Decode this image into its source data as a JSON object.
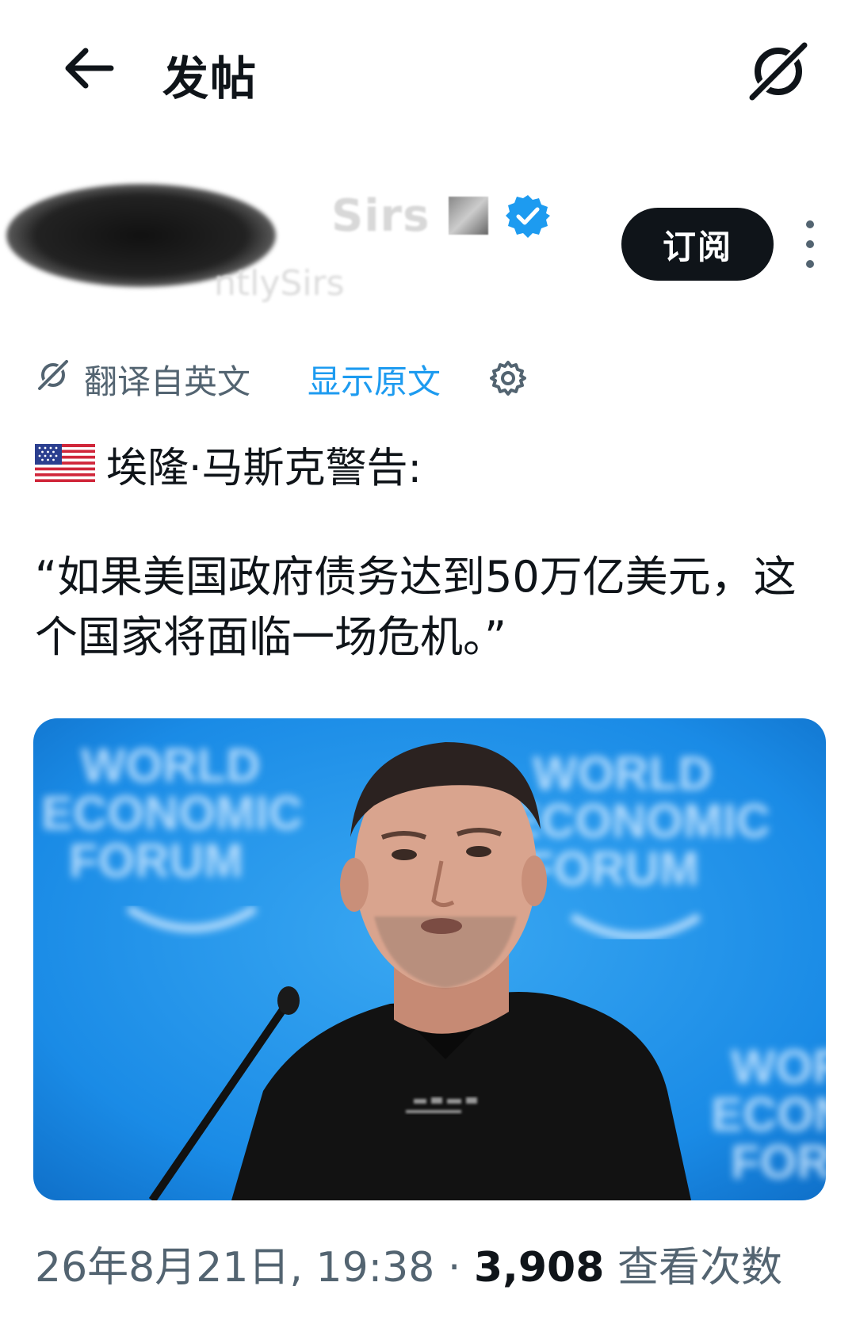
{
  "header": {
    "title": "发帖",
    "back_icon": "arrow-left-icon",
    "grok_icon": "grok-icon"
  },
  "author": {
    "display_name_visible": "Sirs",
    "handle_visible": "ntlySirs",
    "verified": true,
    "verified_color": "#1d9bf0",
    "subscribe_label": "订阅",
    "more_icon": "more-vertical-icon"
  },
  "translation": {
    "label": "翻译自英文",
    "show_original": "显示原文",
    "settings_icon": "gear-icon",
    "link_color": "#1d9bf0"
  },
  "post": {
    "flag_icon": "us-flag-emoji",
    "headline": "埃隆·马斯克警告:",
    "quote": "“如果美国政府债务达到50万亿美元，这个国家将面临一场危机。”",
    "image": {
      "backdrop_text": "WORLD ECONOMIC FORUM",
      "shirt_text": "PRINTED TEXT",
      "accent_color": "#1a8be6"
    }
  },
  "meta": {
    "date_time": "26年8月21日, 19:38",
    "separator": "·",
    "view_count": "3,908",
    "views_label": "查看次数"
  }
}
